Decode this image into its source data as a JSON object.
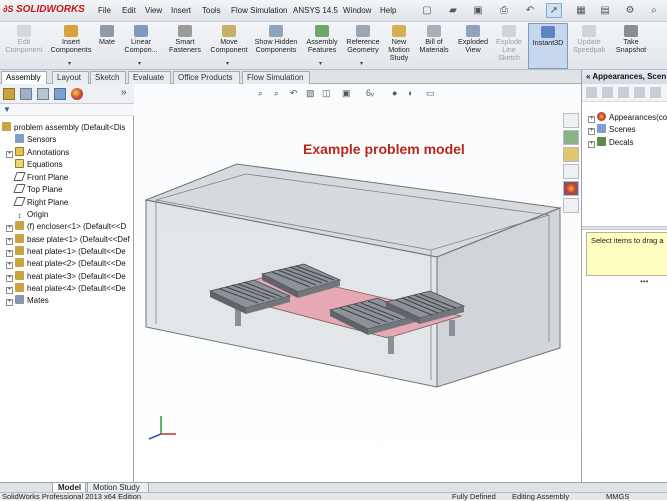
{
  "app": {
    "logo_text": "SOLIDWORKS"
  },
  "menu": [
    "File",
    "Edit",
    "View",
    "Insert",
    "Tools",
    "Flow Simulation",
    "ANSYS 14.5",
    "Window",
    "Help"
  ],
  "commands": [
    {
      "label": "Edit Component",
      "icon": "edit-component-icon",
      "enabled": false
    },
    {
      "label": "Insert Components",
      "icon": "insert-components-icon",
      "enabled": true
    },
    {
      "label": "Mate",
      "icon": "mate-icon",
      "enabled": true
    },
    {
      "label": "Linear Compon...",
      "icon": "linear-pattern-icon",
      "enabled": true
    },
    {
      "label": "Smart Fasteners",
      "icon": "smart-fasteners-icon",
      "enabled": true
    },
    {
      "label": "Move Component",
      "icon": "move-component-icon",
      "enabled": true
    },
    {
      "label": "Show Hidden Components",
      "icon": "show-hidden-icon",
      "enabled": true
    },
    {
      "label": "Assembly Features",
      "icon": "assembly-features-icon",
      "enabled": true
    },
    {
      "label": "Reference Geometry",
      "icon": "reference-geometry-icon",
      "enabled": true
    },
    {
      "label": "New Motion Study",
      "icon": "motion-study-icon",
      "enabled": true
    },
    {
      "label": "Bill of Materials",
      "icon": "bom-icon",
      "enabled": true
    },
    {
      "label": "Exploded View",
      "icon": "exploded-view-icon",
      "enabled": true
    },
    {
      "label": "Explode Line Sketch",
      "icon": "explode-line-icon",
      "enabled": false
    },
    {
      "label": "Instant3D",
      "icon": "instant3d-icon",
      "enabled": true,
      "active": true
    },
    {
      "label": "Update Speedpak",
      "icon": "speedpak-icon",
      "enabled": false
    },
    {
      "label": "Take Snapshot",
      "icon": "snapshot-icon",
      "enabled": true
    }
  ],
  "tabs": [
    {
      "label": "Assembly",
      "active": true
    },
    {
      "label": "Layout",
      "active": false
    },
    {
      "label": "Sketch",
      "active": false
    },
    {
      "label": "Evaluate",
      "active": false
    },
    {
      "label": "Office Products",
      "active": false
    },
    {
      "label": "Flow Simulation",
      "active": false
    }
  ],
  "tree": {
    "root": "problem assembly  (Default<Dis",
    "items": [
      {
        "label": "Sensors",
        "icon": "sensors-icon",
        "expand": false
      },
      {
        "label": "Annotations",
        "icon": "annotations-icon",
        "expand": true
      },
      {
        "label": "Equations",
        "icon": "equations-icon",
        "expand": false
      },
      {
        "label": "Front Plane",
        "icon": "plane-icon",
        "expand": false
      },
      {
        "label": "Top Plane",
        "icon": "plane-icon",
        "expand": false
      },
      {
        "label": "Right Plane",
        "icon": "plane-icon",
        "expand": false
      },
      {
        "label": "Origin",
        "icon": "origin-icon",
        "expand": false
      },
      {
        "label": "(f) encloser<1> (Default<<D",
        "icon": "part-icon",
        "expand": true
      },
      {
        "label": "base plate<1> (Default<<Def",
        "icon": "part-icon",
        "expand": true
      },
      {
        "label": "heat plate<1> (Default<<De",
        "icon": "part-icon",
        "expand": true
      },
      {
        "label": "heat plate<2> (Default<<De",
        "icon": "part-icon",
        "expand": true
      },
      {
        "label": "heat plate<3> (Default<<De",
        "icon": "part-icon",
        "expand": true
      },
      {
        "label": "heat plate<4> (Default<<De",
        "icon": "part-icon",
        "expand": true
      },
      {
        "label": "Mates",
        "icon": "mates-icon",
        "expand": true
      }
    ]
  },
  "graphics": {
    "title": "Example problem model"
  },
  "right_panel": {
    "header": "Appearances, Scen",
    "items": [
      {
        "label": "Appearances(co",
        "icon": "appearances-icon"
      },
      {
        "label": "Scenes",
        "icon": "scenes-icon"
      },
      {
        "label": "Decals",
        "icon": "decals-icon"
      }
    ],
    "note": "Select items to drag a"
  },
  "bottom_tabs": [
    {
      "label": "Model",
      "active": true
    },
    {
      "label": "Motion Study 1",
      "active": false
    }
  ],
  "status": {
    "left": "SolidWorks Professional 2013 x64 Edition",
    "state": "Fully Defined",
    "mode": "Editing Assembly",
    "units": "MMGS"
  },
  "colors": {
    "accent": "#c4161c",
    "title_red": "#b9261c",
    "pcb_pink": "#e6a9b4"
  }
}
